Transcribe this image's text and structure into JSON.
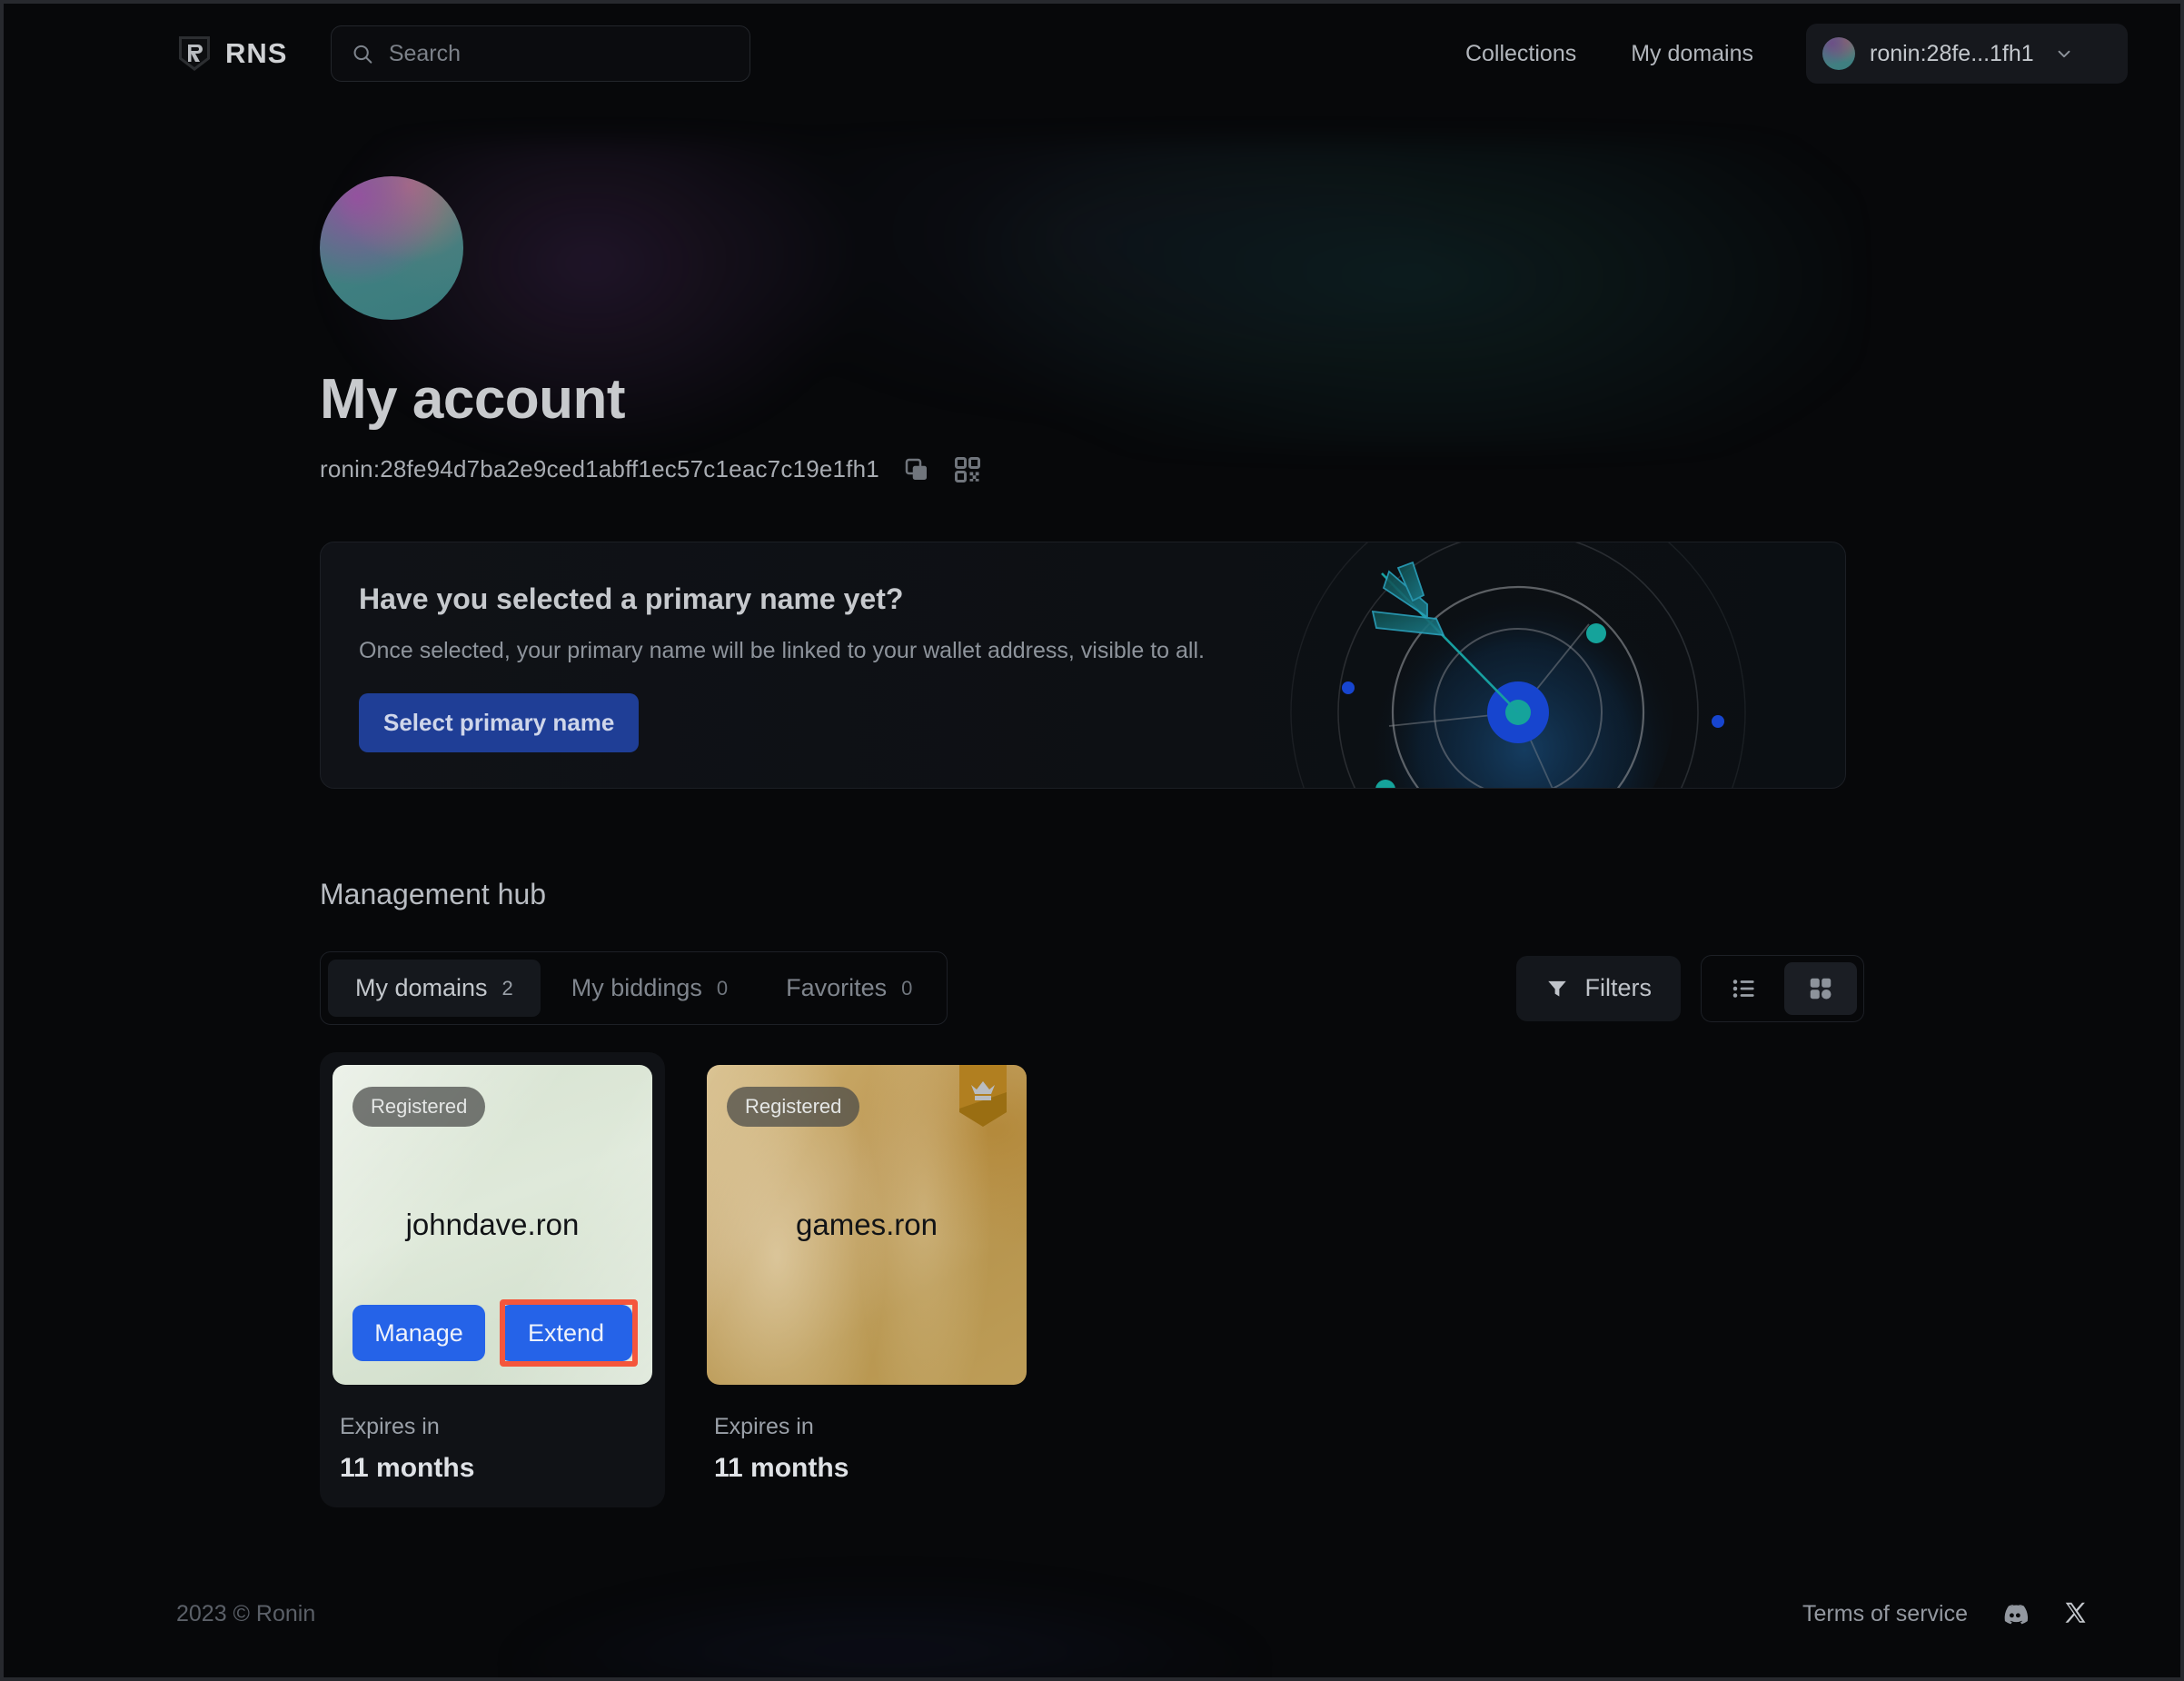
{
  "header": {
    "brand_name": "RNS",
    "brand_logo_icon": "ronin-shield-logo-icon",
    "search": {
      "value": "",
      "placeholder": "Search",
      "icon": "search-icon"
    },
    "nav": [
      {
        "label": "Collections"
      },
      {
        "label": "My domains"
      }
    ],
    "account": {
      "label": "ronin:28fe...1fh1",
      "avatar_icon": "account-avatar",
      "chevron_icon": "chevron-down-icon"
    }
  },
  "profile": {
    "title": "My account",
    "address": "ronin:28fe94d7ba2e9ced1abff1ec57c1eac7c19e1fh1",
    "copy_icon": "copy-icon",
    "qr_icon": "qr-code-icon"
  },
  "promo": {
    "title": "Have you selected a primary name yet?",
    "subtitle": "Once selected, your primary name will be linked to your wallet address, visible to all.",
    "button_label": "Select primary name",
    "illustration_icon": "target-with-arrow-illustration",
    "button_color": "#1f3e96"
  },
  "hub": {
    "title": "Management hub",
    "tabs": [
      {
        "label": "My domains",
        "count": "2",
        "active": true
      },
      {
        "label": "My biddings",
        "count": "0",
        "active": false
      },
      {
        "label": "Favorites",
        "count": "0",
        "active": false
      }
    ],
    "filters_label": "Filters",
    "filters_icon": "funnel-icon",
    "view_list_icon": "list-view-icon",
    "view_grid_icon": "grid-view-icon",
    "active_view": "grid"
  },
  "domains": [
    {
      "name": "johndave.ron",
      "status": "Registered",
      "expires_label": "Expires in",
      "expires_value": "11 months",
      "art": "green",
      "premium": false,
      "focused": true,
      "actions": [
        {
          "label": "Manage",
          "highlighted": false
        },
        {
          "label": "Extend",
          "highlighted": true
        }
      ]
    },
    {
      "name": "games.ron",
      "status": "Registered",
      "expires_label": "Expires in",
      "expires_value": "11 months",
      "art": "gold",
      "premium": true,
      "premium_icon": "crown-badge-icon",
      "focused": false,
      "actions": []
    }
  ],
  "footer": {
    "copyright": "2023 © Ronin",
    "terms_label": "Terms of service",
    "discord_icon": "discord-icon",
    "x_icon": "x-twitter-icon"
  },
  "colors": {
    "accent_blue": "#2563e8",
    "highlight_red": "#f4563c",
    "page_bg": "#07080a"
  }
}
